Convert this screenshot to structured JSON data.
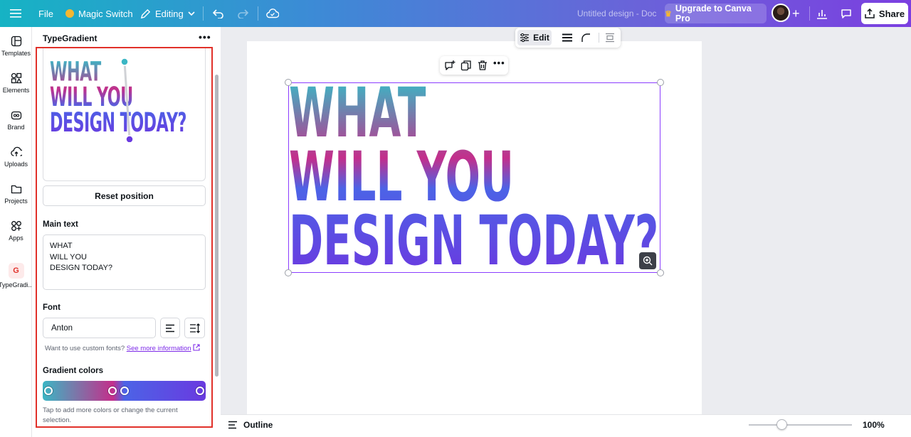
{
  "topbar": {
    "menu_icon": "hamburger-icon",
    "file_label": "File",
    "magic_switch_label": "Magic Switch",
    "editing_label": "Editing",
    "doc_title": "Untitled design - Doc",
    "upgrade_label": "Upgrade to Canva Pro",
    "share_label": "Share",
    "brand_color": "#7b3fe0"
  },
  "rail": {
    "items": [
      {
        "label": "Templates",
        "icon": "templates-icon"
      },
      {
        "label": "Elements",
        "icon": "elements-icon"
      },
      {
        "label": "Brand",
        "icon": "brand-icon"
      },
      {
        "label": "Uploads",
        "icon": "uploads-icon"
      },
      {
        "label": "Projects",
        "icon": "folder-icon"
      },
      {
        "label": "Apps",
        "icon": "apps-icon"
      },
      {
        "label": "TypeGradi...",
        "icon": "typegradient-app-icon"
      }
    ]
  },
  "panel": {
    "title": "TypeGradient",
    "preview_text": "WHAT\nWILL YOU\nDESIGN TODAY?",
    "reset_label": "Reset position",
    "main_text_label": "Main text",
    "main_text_value": "WHAT\nWILL YOU\nDESIGN TODAY?",
    "font_label": "Font",
    "font_value": "Anton",
    "custom_fonts_text": "Want to use custom fonts?",
    "custom_fonts_link": "See more information",
    "gradient_label": "Gradient colors",
    "gradient_help": "Tap to add more colors or change the current selection.",
    "gradient_stops": [
      "#3bb6c4",
      "#c32f8b",
      "#4c63e6",
      "#6a3ae0"
    ],
    "highlight_color": "#e1312a"
  },
  "canvas": {
    "edit_label": "Edit",
    "design_text": "WHAT\nWILL YOU\nDESIGN TODAY?",
    "selection_color": "#8b3dff"
  },
  "bottombar": {
    "outline_label": "Outline",
    "zoom_value": "100%",
    "zoom_percent": 100
  }
}
